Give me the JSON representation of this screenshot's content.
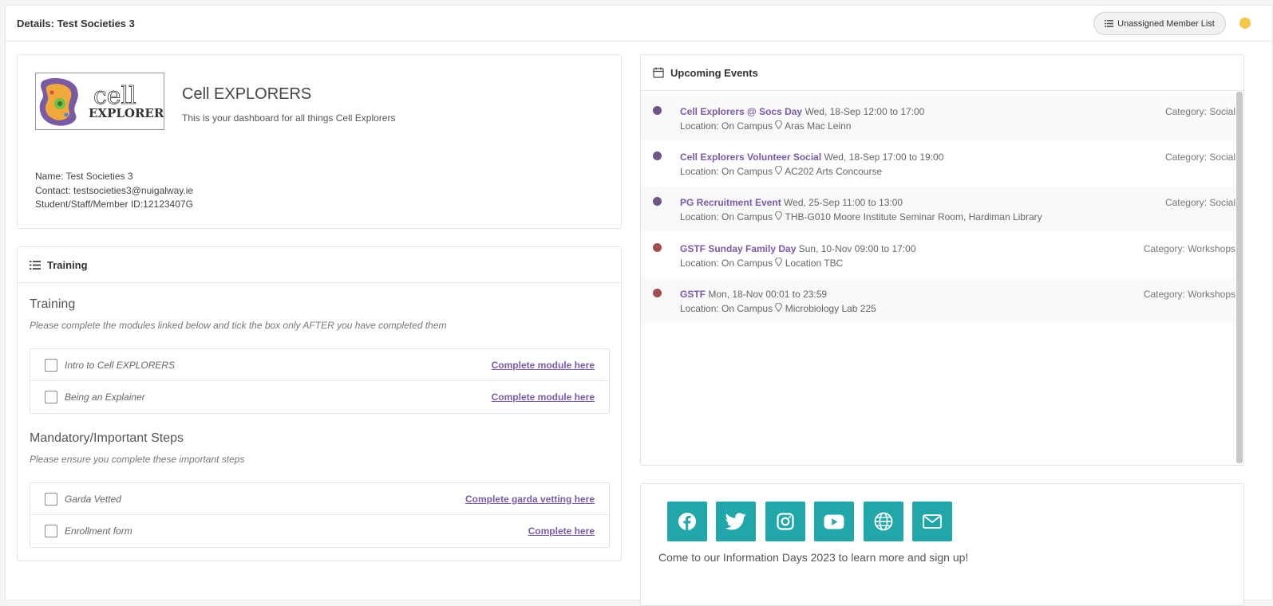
{
  "header": {
    "title": "Details: Test Societies 3",
    "unassigned_button": "Unassigned Member List",
    "status_color": "#f7c54a"
  },
  "profile": {
    "logo_text_top": "cell",
    "logo_text_bottom": "EXPLORERS",
    "name": "Cell EXPLORERS",
    "subtitle": "This is your dashboard for all things Cell Explorers",
    "info_name": "Name: Test Societies 3",
    "info_contact": "Contact: testsocieties3@nuigalway.ie",
    "info_id": "Student/Staff/Member ID:12123407G"
  },
  "training": {
    "card_title": "Training",
    "section1_title": "Training",
    "section1_note": "Please complete the modules linked below and tick the box only AFTER you have completed them",
    "modules": [
      {
        "label": "Intro to Cell EXPLORERS",
        "link": "Complete module here"
      },
      {
        "label": "Being an Explainer",
        "link": "Complete module here"
      }
    ],
    "section2_title": "Mandatory/Important Steps",
    "section2_note": "Please ensure you complete these important steps",
    "steps": [
      {
        "label": "Garda Vetted",
        "link": "Complete garda vetting here"
      },
      {
        "label": "Enrollment form",
        "link": "Complete here"
      }
    ]
  },
  "events": {
    "card_title": "Upcoming Events",
    "items": [
      {
        "name": "Cell Explorers @ Socs Day",
        "datetime": "Wed, 18-Sep 12:00 to 17:00",
        "location": "Location: On Campus",
        "venue": "Aras Mac Leinn",
        "category": "Category: Social",
        "color": "#6e5585"
      },
      {
        "name": "Cell Explorers Volunteer Social",
        "datetime": "Wed, 18-Sep 17:00 to 19:00",
        "location": "Location: On Campus",
        "venue": "AC202 Arts Concourse",
        "category": "Category: Social",
        "color": "#6e5585"
      },
      {
        "name": "PG Recruitment Event",
        "datetime": "Wed, 25-Sep 11:00 to 13:00",
        "location": "Location: On Campus",
        "venue": "THB-G010 Moore Institute Seminar Room, Hardiman Library",
        "category": "Category: Social",
        "color": "#6e5585"
      },
      {
        "name": "GSTF Sunday Family Day",
        "datetime": "Sun, 10-Nov 09:00 to 17:00",
        "location": "Location: On Campus",
        "venue": "Location TBC",
        "category": "Category: Workshops",
        "color": "#a04f4f"
      },
      {
        "name": "GSTF",
        "datetime": "Mon, 18-Nov 00:01 to 23:59",
        "location": "Location: On Campus",
        "venue": "Microbiology Lab 225",
        "category": "Category: Workshops",
        "color": "#a04f4f"
      }
    ]
  },
  "social": {
    "accent": "#21a6aa",
    "icons": [
      "facebook-icon",
      "twitter-icon",
      "instagram-icon",
      "youtube-icon",
      "globe-icon",
      "mail-icon"
    ],
    "tagline": "Come to our Information Days 2023 to learn more and sign up!"
  }
}
